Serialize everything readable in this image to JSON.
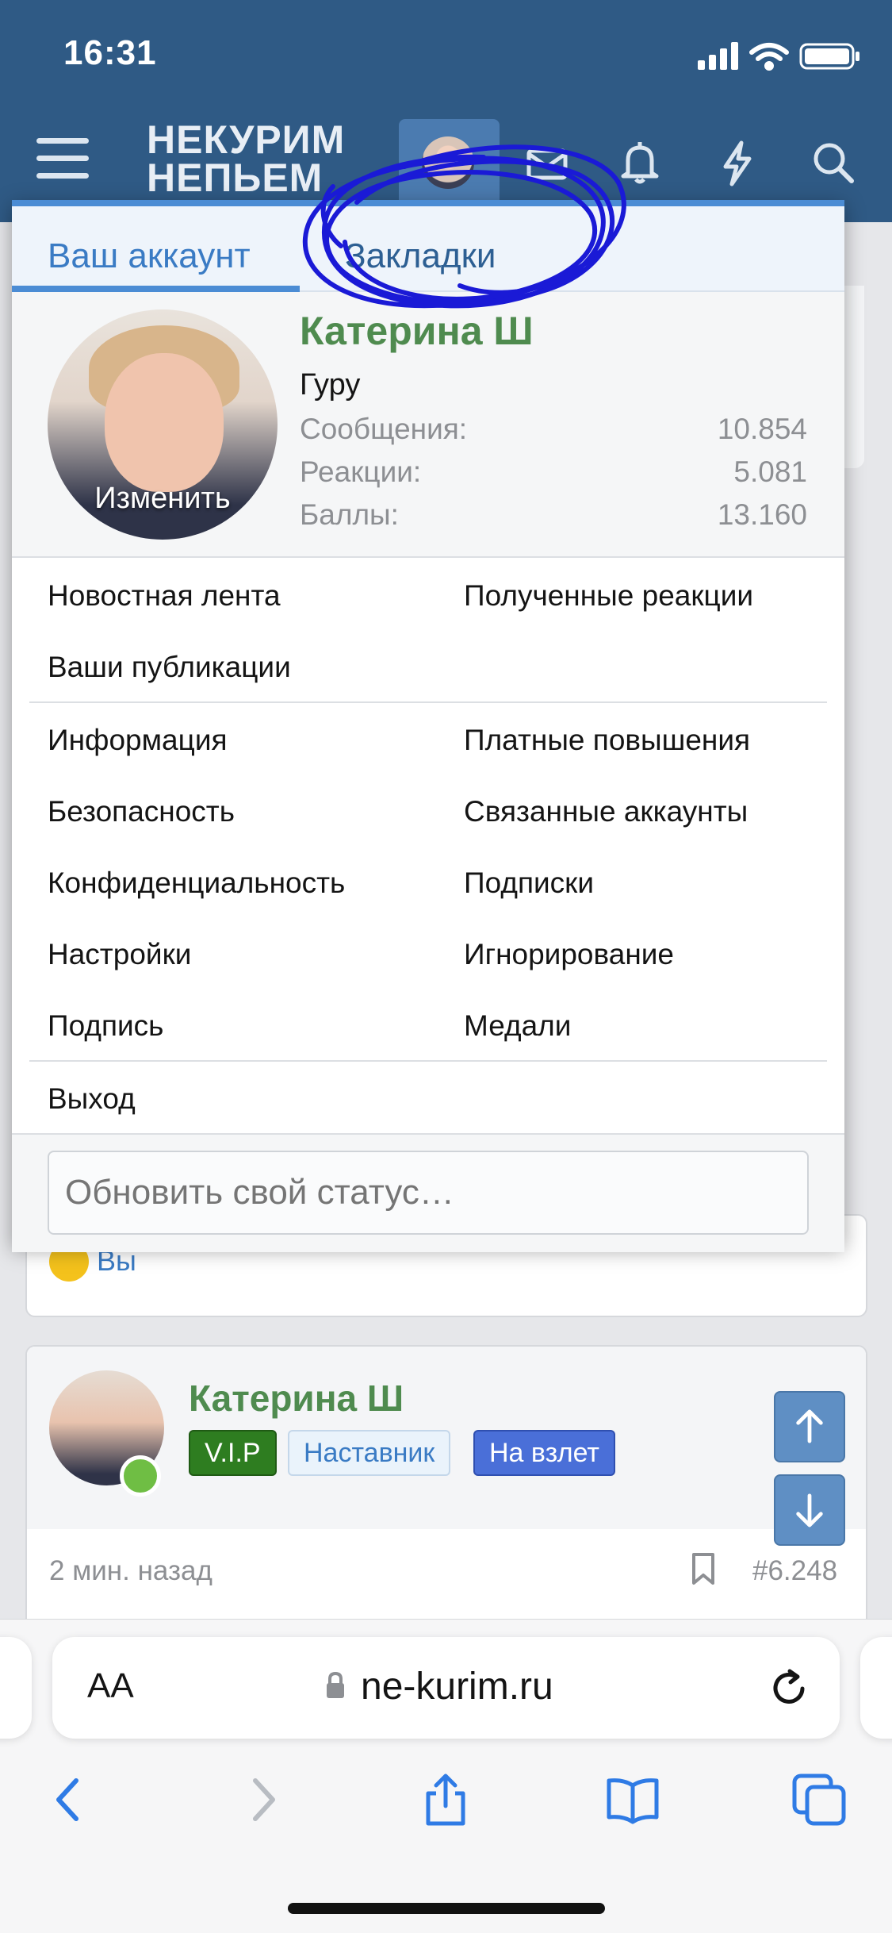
{
  "status_bar": {
    "time": "16:31"
  },
  "header": {
    "logo_line1": "НЕКУРИМ",
    "logo_line2": "НЕПЬЕМ",
    "icons": [
      "menu-icon",
      "avatar",
      "mail-icon",
      "bell-icon",
      "bolt-icon",
      "search-icon"
    ]
  },
  "panel": {
    "tabs": [
      {
        "label": "Ваш аккаунт",
        "active": true
      },
      {
        "label": "Закладки",
        "active": false
      }
    ],
    "profile": {
      "change_label": "Изменить",
      "name": "Катерина Ш",
      "title": "Гуру",
      "stats": [
        {
          "label": "Сообщения:",
          "value": "10.854"
        },
        {
          "label": "Реакции:",
          "value": "5.081"
        },
        {
          "label": "Баллы:",
          "value": "13.160"
        }
      ]
    },
    "menu_group1": {
      "left": [
        "Новостная лента",
        "Ваши публикации"
      ],
      "right": [
        "Полученные реакции"
      ]
    },
    "menu_group2": {
      "left": [
        "Информация",
        "Безопасность",
        "Конфиденциальность",
        "Настройки",
        "Подпись"
      ],
      "right": [
        "Платные повышения",
        "Связанные аккаунты",
        "Подписки",
        "Игнорирование",
        "Медали"
      ]
    },
    "logout": "Выход",
    "status_placeholder": "Обновить свой статус…"
  },
  "reaction": {
    "text": "Вы",
    "emoji": "heart-eyes-emoji"
  },
  "post": {
    "author": "Катерина Ш",
    "badges": [
      "V.I.P",
      "Наставник",
      "На взлет"
    ],
    "time": "2 мин. назад",
    "number": "#6.248"
  },
  "safari": {
    "aa": "AA",
    "url": "ne-kurim.ru"
  },
  "colors": {
    "header_bg": "#2f5a85",
    "accent": "#4b8cd4",
    "username": "#4f8b4f",
    "scribble": "#1a1ad6"
  }
}
